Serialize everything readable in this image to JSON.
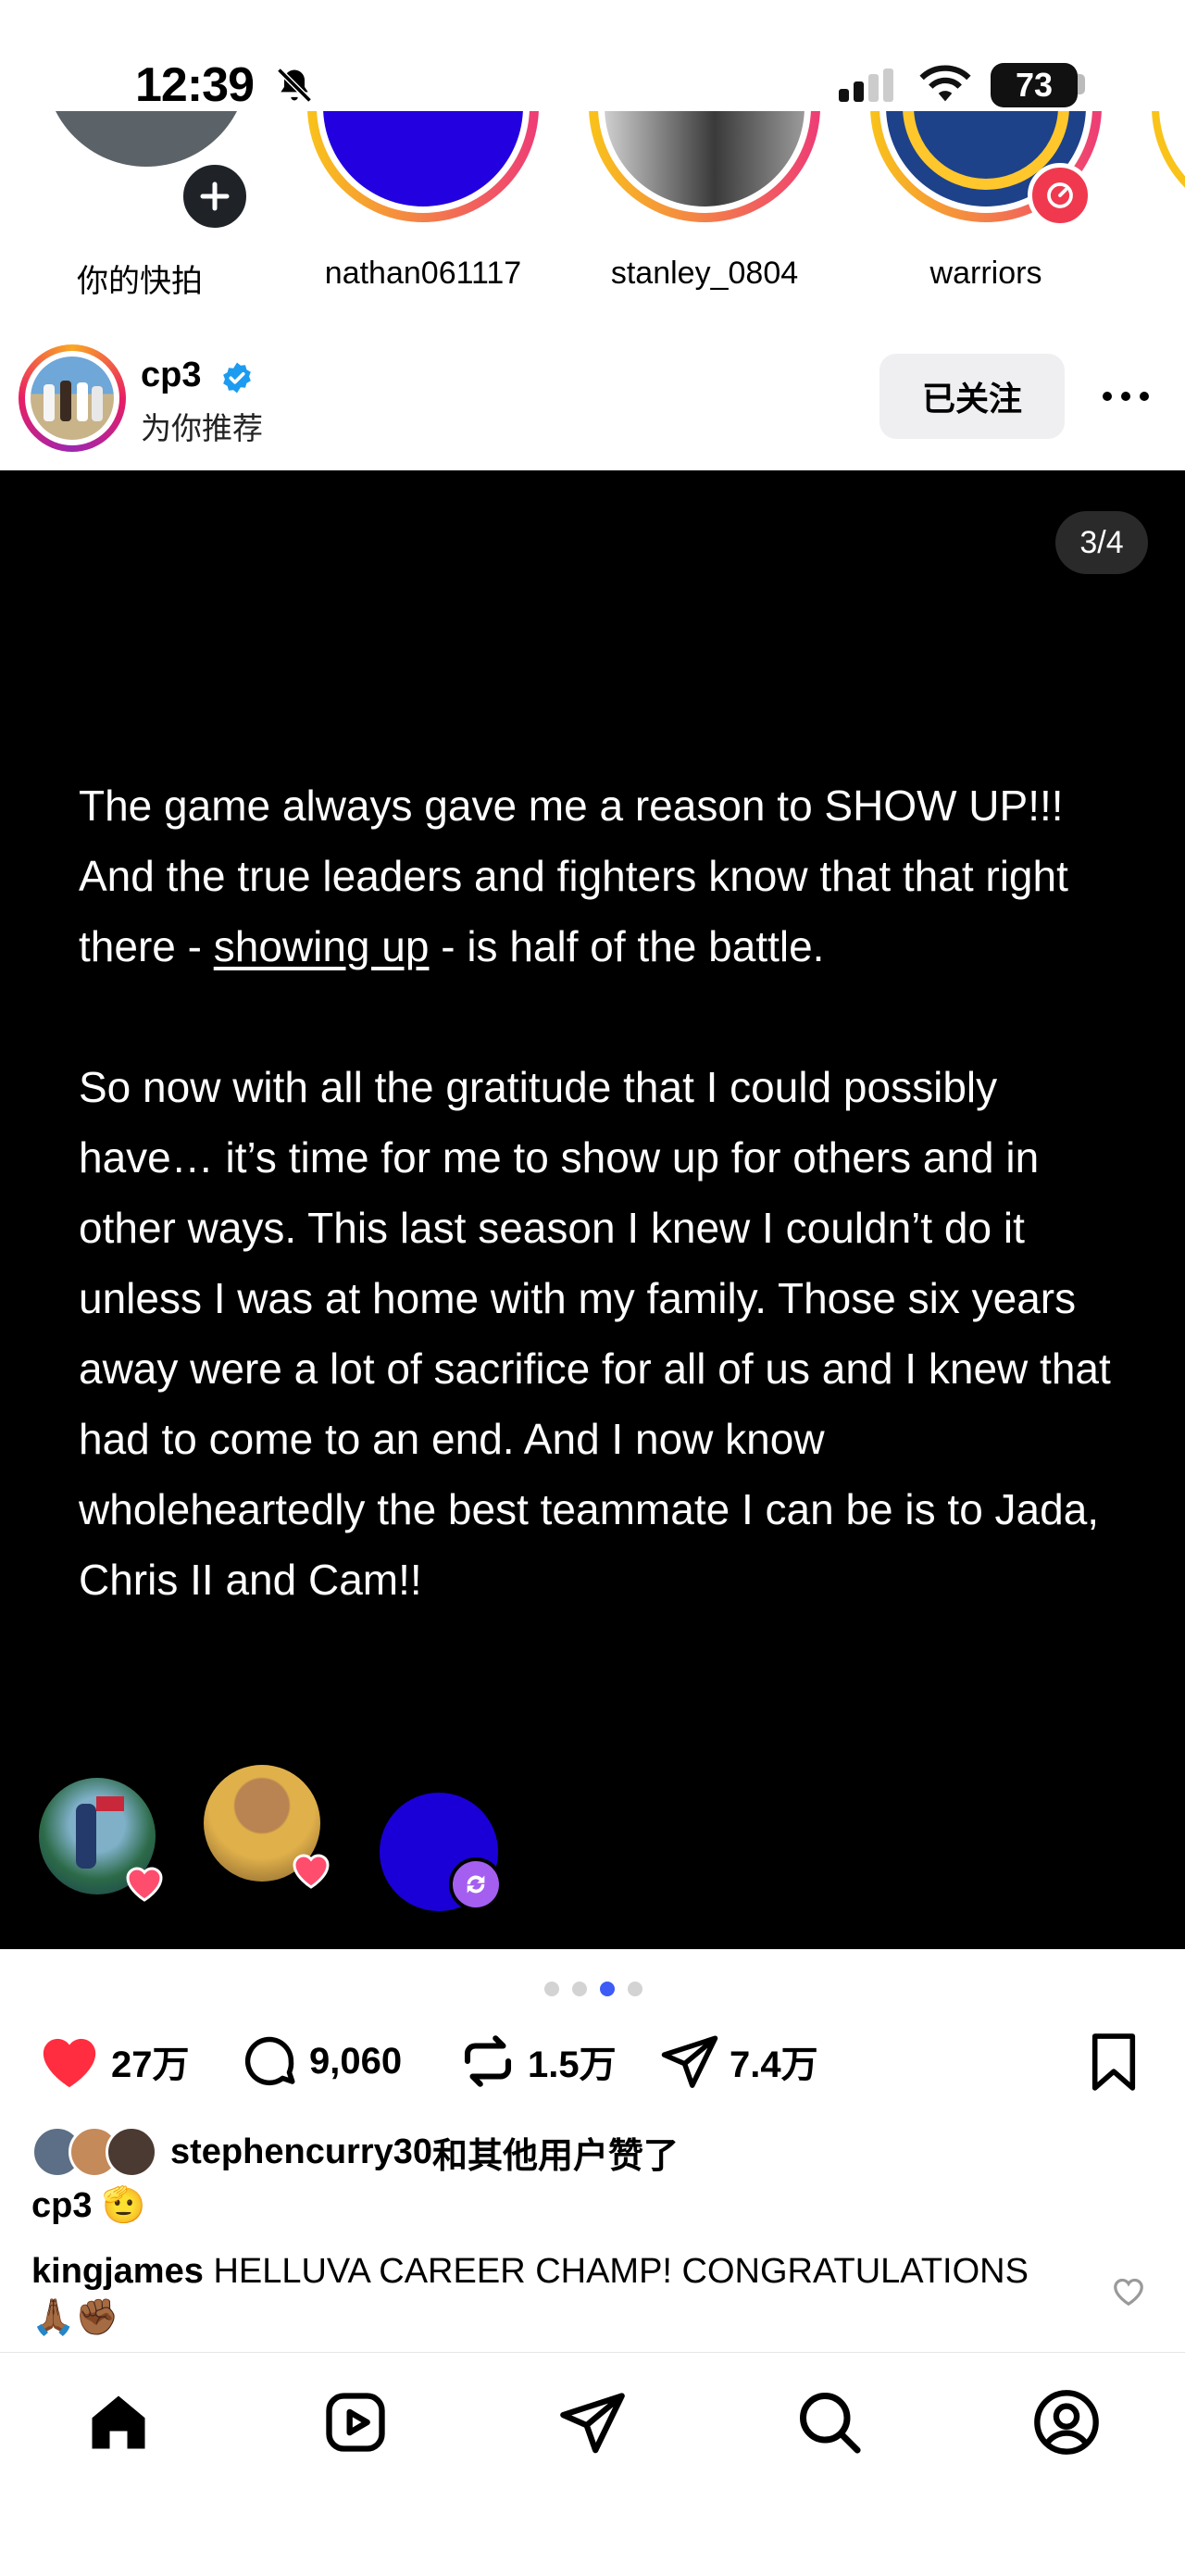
{
  "status_bar": {
    "time": "12:39",
    "battery": "73"
  },
  "stories": [
    {
      "label": "你的快拍"
    },
    {
      "label": "nathan061117"
    },
    {
      "label": "stanley_0804"
    },
    {
      "label": "warriors"
    }
  ],
  "post": {
    "username": "cp3",
    "subtitle": "为你推荐",
    "follow_label": "已关注",
    "counter": "3/4",
    "text": {
      "p1_a": "The game always gave me a reason to SHOW UP!!! And the true leaders and fighters know that that right there - ",
      "p1_link": "showing up",
      "p1_b": " - is half of the battle.",
      "p2": "So now with all the gratitude that I could possibly have… it’s time for me to show up for others and in other ways.  This last season I knew I couldn’t do it unless I was at home with my family. Those six years away were a lot of sacrifice for all of us and I knew that had to come to an end. And I now know wholeheartedly the best teammate I can be is to Jada, Chris II and Cam!!"
    }
  },
  "actions": {
    "likes": "27万",
    "comments": "9,060",
    "reposts": "1.5万",
    "shares": "7.4万"
  },
  "liked_by": {
    "user": "stephencurry30",
    "suffix": "和其他用户赞了"
  },
  "caption": {
    "user": "cp3",
    "emoji": "🫡"
  },
  "comment": {
    "user": "kingjames",
    "text": "HELLUVA CAREER CHAMP! CONGRATULATIONS",
    "emoji": "🙏🏾✊🏾"
  },
  "colors": {
    "like_red": "#ff2d3f",
    "verified_blue": "#1d9bf0",
    "dot_active": "#3d5bf5",
    "repost_purple": "#a45ff0"
  },
  "icons": [
    "home-icon",
    "reels-icon",
    "direct-icon",
    "search-icon",
    "profile-icon"
  ]
}
